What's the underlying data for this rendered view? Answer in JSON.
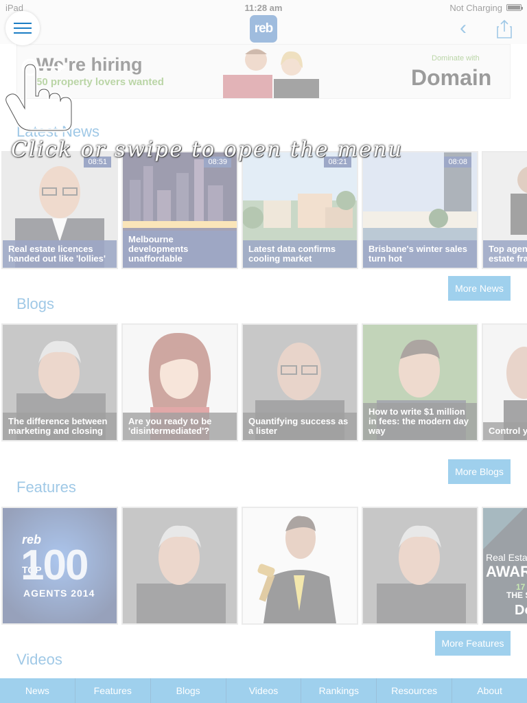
{
  "status_bar": {
    "device": "iPad",
    "time": "11:28 am",
    "battery_text": "Not Charging"
  },
  "nav": {
    "logo": "reb"
  },
  "ad": {
    "headline": "We're hiring",
    "subline": "50 property lovers wanted",
    "tagline": "Dominate with",
    "brand": "Domain"
  },
  "latest_news": {
    "title": "Latest News",
    "items": [
      {
        "time": "08:51",
        "caption": "Real estate licences handed out like 'lollies'"
      },
      {
        "time": "08:39",
        "caption": "Melbourne developments unaffordable"
      },
      {
        "time": "08:21",
        "caption": "Latest data confirms cooling market"
      },
      {
        "time": "08:08",
        "caption": "Brisbane's winter sales turn hot"
      },
      {
        "time": "",
        "caption": "Top agent 'zero tole estate fra"
      }
    ],
    "more_label": "More News"
  },
  "blogs": {
    "title": "Blogs",
    "items": [
      {
        "caption": "The difference between marketing and closing"
      },
      {
        "caption": "Are you ready to be 'disintermediated'?"
      },
      {
        "caption": "Quantifying success as a lister"
      },
      {
        "caption": "How to write $1 million in fees: the modern day way"
      },
      {
        "caption": "Control y conserve"
      }
    ],
    "more_label": "More Blogs"
  },
  "features": {
    "title": "Features",
    "items": [
      {
        "line1": "reb",
        "line2": "TOP",
        "line3": "100",
        "line4": "AGENTS 2014"
      },
      {
        "line1": ""
      },
      {
        "line1": ""
      },
      {
        "line1": ""
      },
      {
        "line1": "Real Esta",
        "line2": "AWAR",
        "line3": "17",
        "line4": "THE S",
        "line5": "Do"
      }
    ],
    "more_label": "More Features"
  },
  "videos": {
    "title": "Videos"
  },
  "tabs": [
    "News",
    "Features",
    "Blogs",
    "Videos",
    "Rankings",
    "Resources",
    "About"
  ],
  "hint": {
    "text": "Click or swipe to open the menu"
  },
  "colors": {
    "accent": "#1b8fd4",
    "caption_bg": "#17307a",
    "title": "#1b7dc4"
  }
}
